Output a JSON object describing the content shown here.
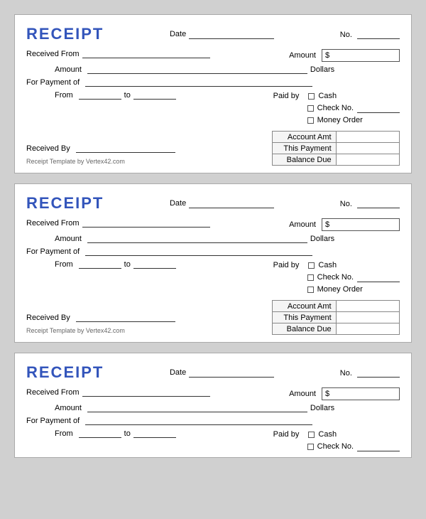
{
  "receipts": [
    {
      "id": 1,
      "title": "RECEIPT",
      "date_label": "Date",
      "no_label": "No.",
      "received_from_label": "Received From",
      "amount_label": "Amount",
      "dollar_sign": "$",
      "amount_suffix": "Dollars",
      "for_payment_label": "For Payment of",
      "from_label": "From",
      "to_label": "to",
      "paid_by_label": "Paid by",
      "cash_label": "Cash",
      "check_label": "Check No.",
      "money_order_label": "Money Order",
      "received_by_label": "Received By",
      "account_amt_label": "Account Amt",
      "this_payment_label": "This Payment",
      "balance_due_label": "Balance Due",
      "footer": "Receipt Template by Vertex42.com"
    },
    {
      "id": 2,
      "title": "RECEIPT",
      "date_label": "Date",
      "no_label": "No.",
      "received_from_label": "Received From",
      "amount_label": "Amount",
      "dollar_sign": "$",
      "amount_suffix": "Dollars",
      "for_payment_label": "For Payment of",
      "from_label": "From",
      "to_label": "to",
      "paid_by_label": "Paid by",
      "cash_label": "Cash",
      "check_label": "Check No.",
      "money_order_label": "Money Order",
      "received_by_label": "Received By",
      "account_amt_label": "Account Amt",
      "this_payment_label": "This Payment",
      "balance_due_label": "Balance Due",
      "footer": "Receipt Template by Vertex42.com"
    },
    {
      "id": 3,
      "title": "RECEIPT",
      "date_label": "Date",
      "no_label": "No.",
      "received_from_label": "Received From",
      "amount_label": "Amount",
      "dollar_sign": "$",
      "amount_suffix": "Dollars",
      "for_payment_label": "For Payment of",
      "from_label": "From",
      "to_label": "to",
      "paid_by_label": "Paid by",
      "cash_label": "Cash",
      "check_label": "Check No.",
      "footer": ""
    }
  ]
}
